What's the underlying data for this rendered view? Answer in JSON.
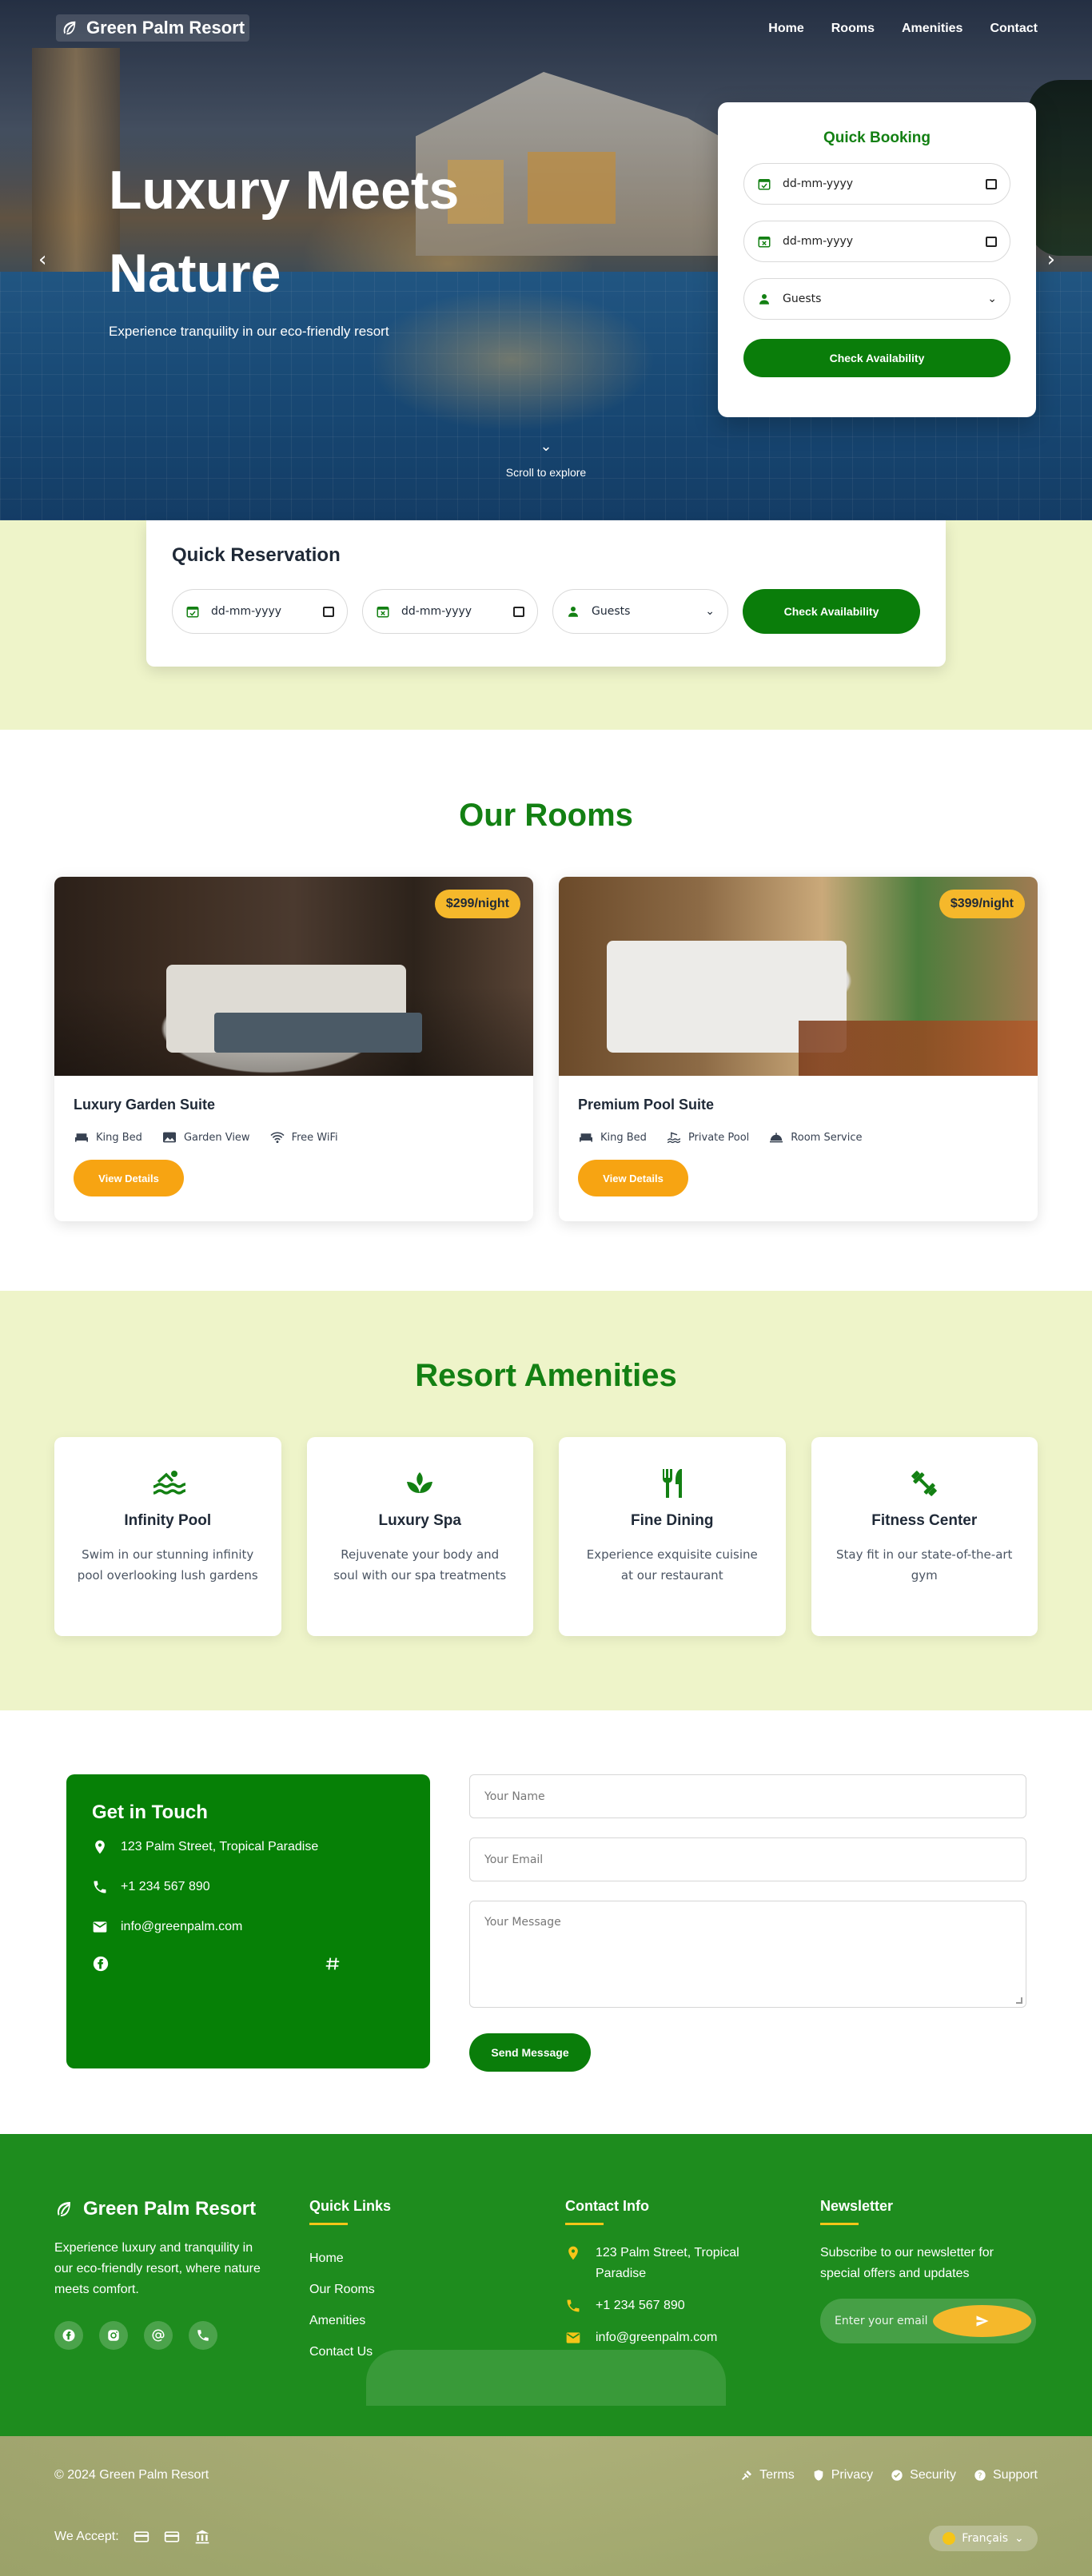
{
  "brand": {
    "name": "Green Palm Resort"
  },
  "nav": {
    "home": "Home",
    "rooms": "Rooms",
    "amenities": "Amenities",
    "contact": "Contact"
  },
  "hero": {
    "title": "Luxury Meets Nature",
    "subtitle": "Experience tranquility in our eco-friendly resort",
    "scroll_label": "Scroll to explore"
  },
  "quick_booking": {
    "title": "Quick Booking",
    "checkin_placeholder": "dd-mm-yyyy",
    "checkout_placeholder": "dd-mm-yyyy",
    "guests_label": "Guests",
    "button": "Check Availability"
  },
  "quick_reservation": {
    "title": "Quick Reservation",
    "checkin_placeholder": "dd-mm-yyyy",
    "checkout_placeholder": "dd-mm-yyyy",
    "guests_label": "Guests",
    "button": "Check Availability"
  },
  "rooms": {
    "title": "Our Rooms",
    "items": [
      {
        "name": "Luxury Garden Suite",
        "price": "$299/night",
        "features": [
          "King Bed",
          "Garden View",
          "Free WiFi"
        ],
        "button": "View Details"
      },
      {
        "name": "Premium Pool Suite",
        "price": "$399/night",
        "features": [
          "King Bed",
          "Private Pool",
          "Room Service"
        ],
        "button": "View Details"
      }
    ]
  },
  "amenities": {
    "title": "Resort Amenities",
    "items": [
      {
        "name": "Infinity Pool",
        "desc": "Swim in our stunning infinity pool overlooking lush gardens",
        "icon": "pool-icon"
      },
      {
        "name": "Luxury Spa",
        "desc": "Rejuvenate your body and soul with our spa treatments",
        "icon": "spa-icon"
      },
      {
        "name": "Fine Dining",
        "desc": "Experience exquisite cuisine at our restaurant",
        "icon": "dining-icon"
      },
      {
        "name": "Fitness Center",
        "desc": "Stay fit in our state-of-the-art gym",
        "icon": "fitness-icon"
      }
    ]
  },
  "contact": {
    "title": "Get in Touch",
    "address": "123 Palm Street, Tropical Paradise",
    "phone": "+1 234 567 890",
    "email": "info@greenpalm.com",
    "form": {
      "name_placeholder": "Your Name",
      "email_placeholder": "Your Email",
      "message_placeholder": "Your Message",
      "button": "Send Message"
    }
  },
  "footer": {
    "brand_name": "Green Palm Resort",
    "description": "Experience luxury and tranquility in our eco-friendly resort, where nature meets comfort.",
    "quick_links_title": "Quick Links",
    "quick_links": [
      "Home",
      "Our Rooms",
      "Amenities",
      "Contact Us"
    ],
    "contact_title": "Contact Info",
    "address": "123 Palm Street, Tropical Paradise",
    "phone": "+1 234 567 890",
    "email": "info@greenpalm.com",
    "newsletter_title": "Newsletter",
    "newsletter_text": "Subscribe to our newsletter for special offers and updates",
    "newsletter_placeholder": "Enter your email",
    "copyright": "© 2024 Green Palm Resort",
    "legal": [
      "Terms",
      "Privacy",
      "Security",
      "Support"
    ],
    "we_accept": "We Accept:",
    "language": "Français"
  },
  "colors": {
    "primary_green": "#0a7d0a",
    "accent_yellow": "#f5b82b",
    "accent_orange": "#f7a412",
    "pale_green_bg": "#eef4c9"
  }
}
